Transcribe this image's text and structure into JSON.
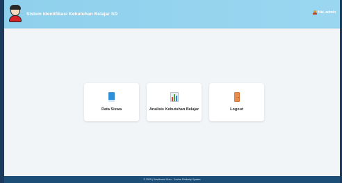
{
  "header": {
    "title": "Sistem Identifikasi Kebutuhan Belajar SD",
    "greeting": "Hai, admin",
    "avatar_icon": "student-avatar-icon",
    "user_icon": "user-icon"
  },
  "menu": {
    "cards": [
      {
        "label": "Data Siswa",
        "icon": "book-icon",
        "icon_color": "#2e8fd6"
      },
      {
        "label": "Analisis Kebutuhan Belajar",
        "icon": "bar-chart-icon",
        "icon_color": "#43a047"
      },
      {
        "label": "Logout",
        "icon": "door-icon",
        "icon_color": "#d9773a"
      }
    ]
  },
  "footer": {
    "text": "© 2025 | Dashboard Guru - Cosine Similarity System"
  },
  "colors": {
    "header_bg": "#8fd0ec",
    "main_bg": "#f2f5f8",
    "footer_bg": "#1d4e78",
    "frame": "#1b3a5c"
  }
}
